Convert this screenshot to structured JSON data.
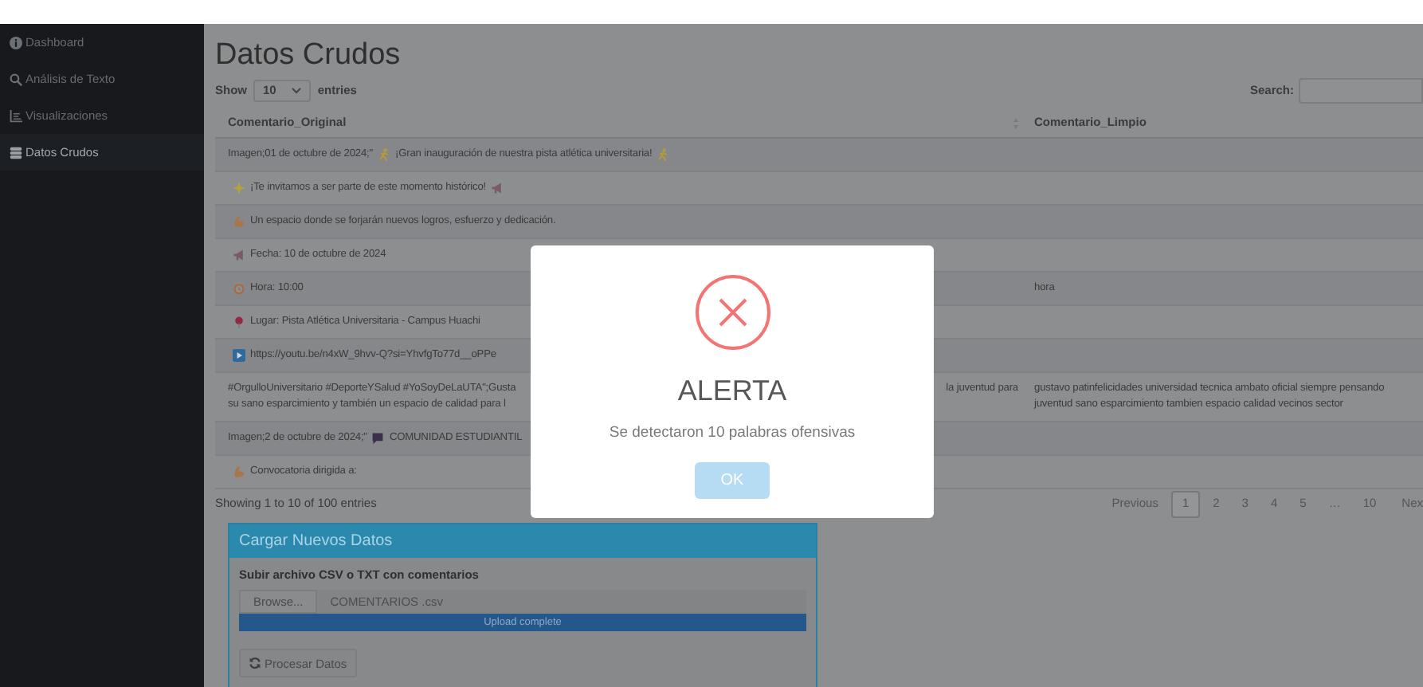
{
  "sidebar": {
    "items": [
      {
        "label": "Dashboard",
        "selected": false
      },
      {
        "label": "Análisis de Texto",
        "selected": false
      },
      {
        "label": "Visualizaciones",
        "selected": false
      },
      {
        "label": "Datos Crudos",
        "selected": true
      }
    ]
  },
  "page_title": "Datos Crudos",
  "table_controls": {
    "show_label": "Show",
    "page_size": "10",
    "entries_label": "entries",
    "search_label": "Search:"
  },
  "table": {
    "columns": [
      "Comentario_Original",
      "Comentario_Limpio"
    ],
    "rows": [
      {
        "comentario_original": [
          {
            "kind": "text",
            "text": "Imagen;01 de octubre de 2024;\""
          },
          {
            "kind": "runner"
          },
          {
            "kind": "text",
            "text": "¡Gran inauguración de nuestra pista atlética universitaria!"
          },
          {
            "kind": "runner"
          }
        ]
      },
      {
        "comentario_original": [
          {
            "kind": "sparkle"
          },
          {
            "kind": "text",
            "text": "¡Te invitamos a ser parte de este momento histórico!"
          },
          {
            "kind": "megaphone"
          }
        ]
      },
      {
        "comentario_original": [
          {
            "kind": "muscle"
          },
          {
            "kind": "text",
            "text": "Un espacio donde se forjarán nuevos logros, esfuerzo y dedicación."
          }
        ]
      },
      {
        "comentario_original": [
          {
            "kind": "megaphone"
          },
          {
            "kind": "text",
            "text": "Fecha: 10 de octubre de 2024"
          }
        ]
      },
      {
        "comentario_original": [
          {
            "kind": "clock"
          },
          {
            "kind": "text",
            "text": "Hora: 10:00"
          }
        ],
        "comentario_limpio": "hora"
      },
      {
        "comentario_original": [
          {
            "kind": "pin"
          },
          {
            "kind": "text",
            "text": "Lugar: Pista Atlética Universitaria - Campus Huachi"
          }
        ]
      },
      {
        "comentario_original": [
          {
            "kind": "play"
          },
          {
            "kind": "text",
            "text": "https://youtu.be/n4xW_9hvv-Q?si=YhvfgTo77d__oPPe"
          }
        ]
      },
      {
        "comentario_original": [
          {
            "kind": "text",
            "text": "#OrgulloUniversitario #DeporteYSalud #YoSoyDeLaUTA\";Gusta"
          },
          {
            "kind": "break"
          },
          {
            "kind": "text",
            "text": "su sano esparcimiento y también un espacio de calidad para l"
          },
          {
            "kind": "right_text",
            "text": "la juventud para"
          }
        ],
        "comentario_limpio": "gustavo patinfelicidades universidad tecnica ambato oficial siempre pensando juventud sano esparcimiento tambien espacio calidad vecinos sector"
      },
      {
        "comentario_original": [
          {
            "kind": "text",
            "text": "Imagen;2 de octubre de 2024;\""
          },
          {
            "kind": "speech"
          },
          {
            "kind": "text",
            "text": "COMUNIDAD ESTUDIANTIL"
          }
        ]
      },
      {
        "comentario_original": [
          {
            "kind": "muscle"
          },
          {
            "kind": "text",
            "text": "Convocatoria dirigida a:"
          }
        ]
      }
    ]
  },
  "info": "Showing 1 to 10 of 100 entries",
  "pagination": {
    "previous": "Previous",
    "pages": [
      {
        "label": "1",
        "selected": true
      },
      {
        "label": "2",
        "selected": false
      },
      {
        "label": "3",
        "selected": false
      },
      {
        "label": "4",
        "selected": false
      },
      {
        "label": "5",
        "selected": false
      },
      {
        "label": "…",
        "selected": false
      },
      {
        "label": "10",
        "selected": false
      }
    ],
    "next": "Nex"
  },
  "upload_card": {
    "title": "Cargar Nuevos Datos",
    "field_label": "Subir archivo CSV o TXT con comentarios",
    "browse": "Browse...",
    "file_name": "COMENTARIOS .csv",
    "level": 1,
    "progress_text": "Upload complete",
    "process_button": "Procesar Datos"
  },
  "alert": {
    "title": "ALERTA",
    "message": "Se detectaron 10 palabras ofensivas",
    "button": "OK"
  }
}
